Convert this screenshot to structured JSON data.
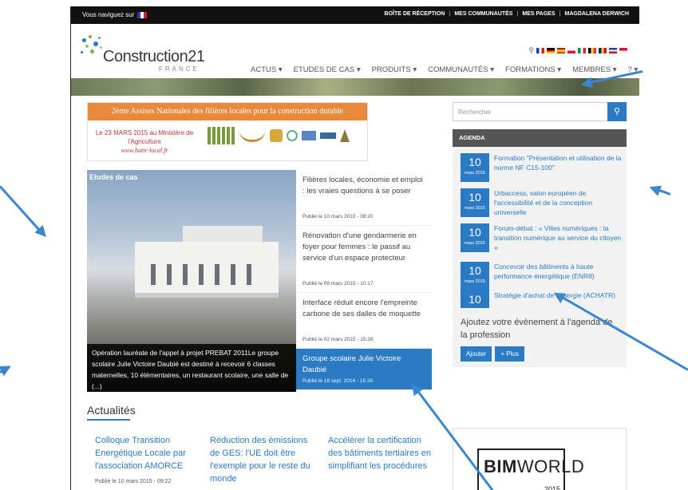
{
  "topbar": {
    "browse_label": "Vous naviguez sur",
    "links": [
      "BOÎTE DE RÉCEPTION",
      "MES COMMUNAUTÉS",
      "MES PAGES",
      "MAGDALENA DERWICH"
    ],
    "separator": "|"
  },
  "logo": {
    "name": "Construction21",
    "country": "FRANCE"
  },
  "menu": [
    {
      "label": "ACTUS",
      "caret": "▾"
    },
    {
      "label": "ETUDES DE CAS",
      "caret": "▾"
    },
    {
      "label": "PRODUITS",
      "caret": "▾"
    },
    {
      "label": "COMMUNAUTÉS",
      "caret": "▾"
    },
    {
      "label": "FORMATIONS",
      "caret": "▾"
    },
    {
      "label": "MEMBRES",
      "caret": "▾"
    },
    {
      "label": "?",
      "caret": "▾"
    }
  ],
  "promo": {
    "title": "2ème Assises Nationales des filières locales pour la construction durable",
    "date_line": "Le 23 MARS 2015 au Ministère de l'Agriculture",
    "site": "www.batir-local.fr"
  },
  "hero": {
    "tag": "Etudes de cas",
    "caption": "Opération lauréate de l'appel à projet PREBAT 2011Le groupe scolaire Julie Victoire Daubié est destiné à recevoir 6 classes maternelles, 10 élémentaires, un restaurant scolaire, une salle de (...)"
  },
  "news": [
    {
      "title": "Filières locales, économie et emploi : les vraies questions à se poser",
      "date": "Publié le 10 mars 2015 - 08:20"
    },
    {
      "title": "Rénovation d'une gendarmerie en foyer pour femmes : le passif au service d'un espace protecteur",
      "date": "Publié le 09 mars 2015 - 10:17"
    },
    {
      "title": "Interface réduit encore l'empreinte carbone de ses dalles de moquette",
      "date": "Publié le 02 mars 2015 - 15:39"
    },
    {
      "title": "Groupe scolaire Julie Victoire Daubié",
      "date": "Publié le 18 sept. 2014 - 15:26"
    }
  ],
  "actualites": {
    "title": "Actualités",
    "items": [
      {
        "title": "Colloque Transition Energétique Locale par l'association AMORCE",
        "date": "Publié le 10 mars 2015 - 09:22"
      },
      {
        "title": "Réduction des émissions de GES: l'UE doit être l'exemple pour le reste du monde"
      },
      {
        "title": "Accélérer la certification des bâtiments tertiaires en simplifiant les procédures"
      }
    ]
  },
  "search": {
    "placeholder": "Rechercher"
  },
  "agenda": {
    "title": "AGENDA",
    "events": [
      {
        "day": "10",
        "month": "mars 2015",
        "title": "Formation \"Présentation et utilisation de la norme NF C15-100\""
      },
      {
        "day": "10",
        "month": "mars 2015",
        "title": "Urbaccess, salon européen de l'accessibilité et de la conception universelle"
      },
      {
        "day": "10",
        "month": "mars 2015",
        "title": "Forum-débat : « Villes numériques : la transition numérique au service du citoyen »"
      },
      {
        "day": "10",
        "month": "mars 2015",
        "title": "Concevoir des bâtiments à haute performance énergétique (ENR8)"
      },
      {
        "day": "10",
        "month": "",
        "title": "Stratégie d'achat de l'énergie (ACHATR)"
      }
    ],
    "add_text": "Ajoutez votre évènement à l'agenda de la profession",
    "add_button": "Ajouter",
    "more_button": "+ Plus"
  },
  "bim": {
    "brand_bold": "BIM",
    "brand_light": "WORLD",
    "year": "2015"
  },
  "colors": {
    "accent": "#2b7bc4",
    "promo_orange": "#e8893b",
    "topbar": "#111111"
  }
}
